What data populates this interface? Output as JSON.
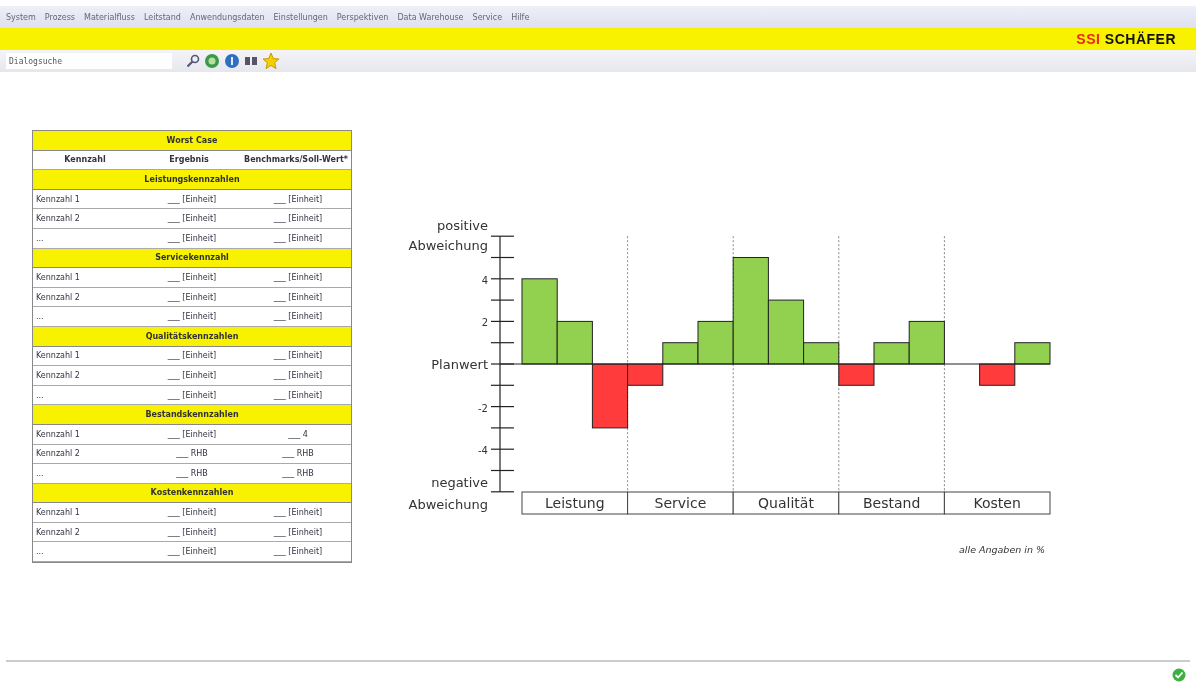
{
  "menu_bar": {
    "items": [
      "System",
      "Prozess",
      "Materialfluss",
      "Leitstand",
      "Anwendungsdaten",
      "Einstellungen",
      "Perspektiven",
      "Data Warehouse",
      "Service",
      "Hilfe"
    ]
  },
  "logo": {
    "mark": "SSI",
    "name": "SCHÄFER"
  },
  "toolbar": {
    "search": {
      "placeholder": "Dialogsuche"
    }
  },
  "table": {
    "title": "Worst Case",
    "columns": [
      "Kennzahl",
      "Ergebnis",
      "Benchmarks/Soll-Wert*"
    ],
    "sections": [
      {
        "title": "Leistungskennzahlen",
        "rows": [
          [
            "Kennzahl 1",
            "___ [Einheit]",
            "___ [Einheit]"
          ],
          [
            "Kennzahl 2",
            "___ [Einheit]",
            "___ [Einheit]"
          ],
          [
            "...",
            "___ [Einheit]",
            "___ [Einheit]"
          ]
        ]
      },
      {
        "title": "Servicekennzahl",
        "rows": [
          [
            "Kennzahl 1",
            "___ [Einheit]",
            "___ [Einheit]"
          ],
          [
            "Kennzahl 2",
            "___ [Einheit]",
            "___ [Einheit]"
          ],
          [
            "...",
            "___ [Einheit]",
            "___ [Einheit]"
          ]
        ]
      },
      {
        "title": "Qualitätskennzahlen",
        "rows": [
          [
            "Kennzahl 1",
            "___ [Einheit]",
            "___ [Einheit]"
          ],
          [
            "Kennzahl 2",
            "___ [Einheit]",
            "___ [Einheit]"
          ],
          [
            "...",
            "___ [Einheit]",
            "___ [Einheit]"
          ]
        ]
      },
      {
        "title": "Bestandskennzahlen",
        "rows": [
          [
            "Kennzahl 1",
            "___ [Einheit]",
            "___ 4"
          ],
          [
            "Kennzahl 2",
            "___ RHB",
            "___ RHB"
          ],
          [
            "...",
            "___ RHB",
            "___ RHB"
          ]
        ]
      },
      {
        "title": "Kostenkennzahlen",
        "rows": [
          [
            "Kennzahl 1",
            "___ [Einheit]",
            "___ [Einheit]"
          ],
          [
            "Kennzahl 2",
            "___ [Einheit]",
            "___ [Einheit]"
          ],
          [
            "...",
            "___ [Einheit]",
            "___ [Einheit]"
          ]
        ]
      }
    ]
  },
  "chart": {
    "chart_data": {
      "type": "bar",
      "categories": [
        "Leistung",
        "Service",
        "Qualität",
        "Bestand",
        "Kosten"
      ],
      "series": [
        {
          "color": "#92d050",
          "values": [
            4,
            null,
            5,
            null,
            null
          ]
        },
        {
          "color": "#92d050",
          "values": [
            2,
            1,
            3,
            1,
            null
          ]
        },
        {
          "color": "#92d050",
          "values": [
            null,
            2,
            1,
            2,
            1
          ]
        },
        {
          "color": "#ff3b3b",
          "values": [
            null,
            -1,
            null,
            -1,
            null
          ]
        },
        {
          "color": "#ff3b3b",
          "values": [
            null,
            null,
            null,
            null,
            -1
          ]
        },
        {
          "color": "#ff3b3b",
          "values": [
            -3,
            null,
            null,
            null,
            null
          ]
        }
      ],
      "ylim": [
        -6,
        6
      ],
      "yticks": [
        {
          "value": 4,
          "label": "4"
        },
        {
          "value": 2,
          "label": "2"
        },
        {
          "value": 0,
          "label": "Planwert"
        },
        {
          "value": -2,
          "label": "-2"
        },
        {
          "value": -4,
          "label": "-4"
        }
      ]
    },
    "top_label": [
      "positive",
      "Abweichung"
    ],
    "bottom_label": [
      "negative",
      "Abweichung"
    ],
    "note": "alle Angaben in %"
  },
  "status_bar": {
    "ok": true
  }
}
